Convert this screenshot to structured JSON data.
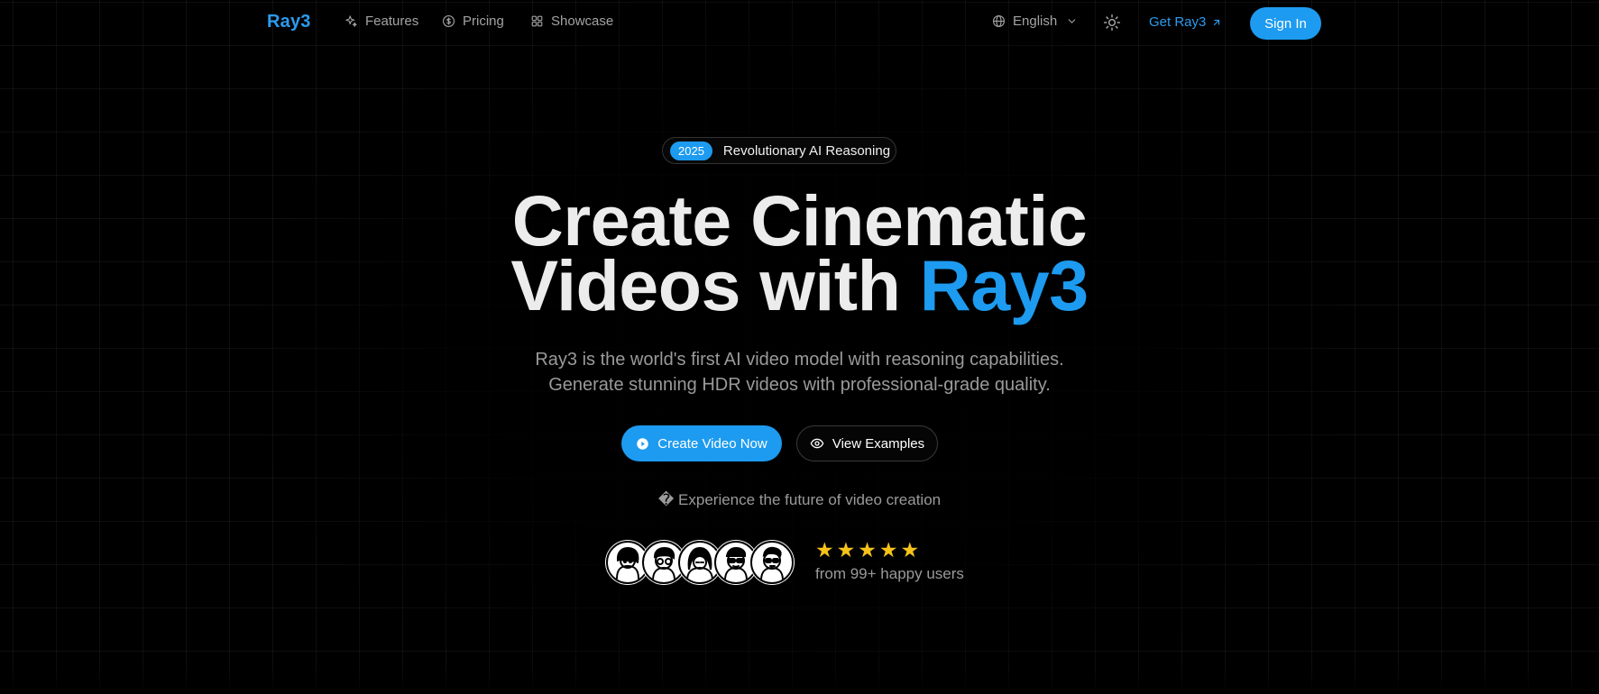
{
  "nav": {
    "logo": "Ray3",
    "links": [
      {
        "label": "Features",
        "icon": "sparkles-icon"
      },
      {
        "label": "Pricing",
        "icon": "dollar-circle-icon"
      },
      {
        "label": "Showcase",
        "icon": "grid-icon"
      }
    ],
    "language": "English",
    "get_label": "Get Ray3",
    "sign_in_label": "Sign In"
  },
  "hero": {
    "badge_year": "2025",
    "badge_text": "Revolutionary AI Reasoning",
    "headline_line1": "Create Cinematic",
    "headline_line2_prefix": "Videos with",
    "headline_accent": "Ray3",
    "subtitle_line1": "Ray3 is the world's first AI video model with reasoning capabilities.",
    "subtitle_line2": "Generate stunning HDR videos with professional-grade quality.",
    "primary_button": "Create Video Now",
    "secondary_button": "View Examples",
    "tagline": "� Experience the future of video creation",
    "rating_stars": 5,
    "users_text": "from 99+ happy users"
  },
  "colors": {
    "accent": "#1d9bf0",
    "background": "#000000",
    "star": "#f7c21a"
  }
}
